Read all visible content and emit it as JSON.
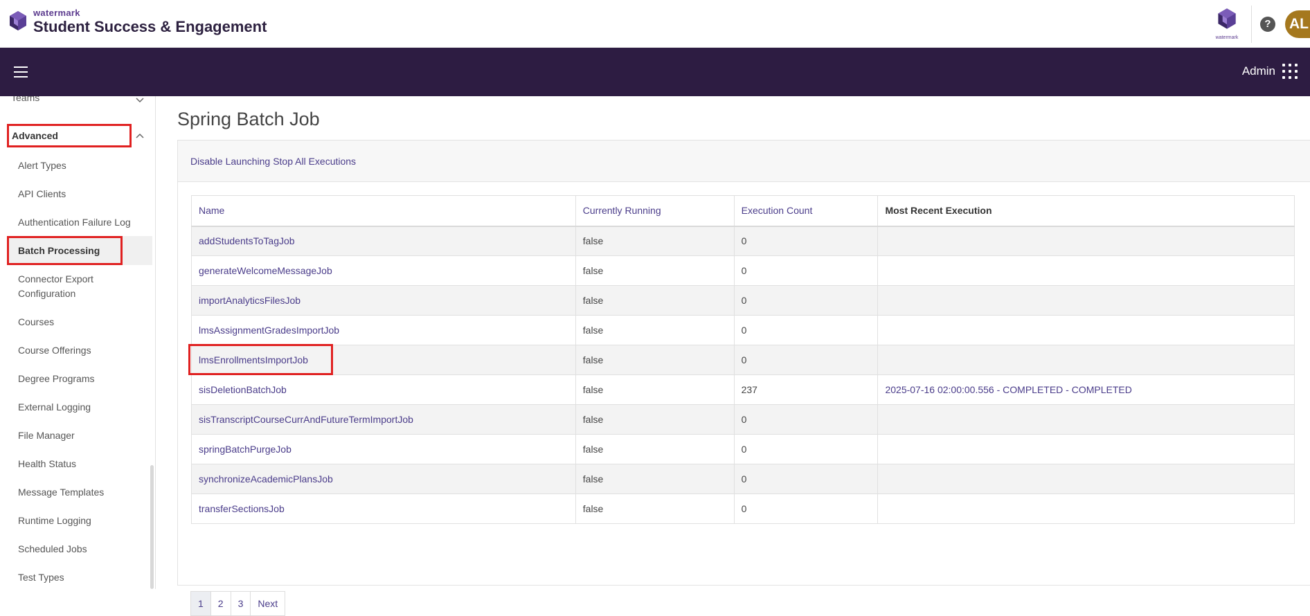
{
  "header": {
    "brand_small": "watermark",
    "brand_big": "Student Success & Engagement",
    "wm_caption": "watermark",
    "help_glyph": "?",
    "avatar_initials": "AL"
  },
  "navbar": {
    "admin_label": "Admin"
  },
  "sidebar": {
    "teams_label": "Teams",
    "advanced_label": "Advanced",
    "items": [
      "Alert Types",
      "API Clients",
      "Authentication Failure Log",
      "Batch Processing",
      "Connector Export",
      "Configuration",
      "Courses",
      "Course Offerings",
      "Degree Programs",
      "External Logging",
      "File Manager",
      "Health Status",
      "Message Templates",
      "Runtime Logging",
      "Scheduled Jobs",
      "Test Types"
    ]
  },
  "main": {
    "title": "Spring Batch Job",
    "actions": {
      "disable": "Disable Launching",
      "stop": "Stop All Executions"
    },
    "columns": {
      "name": "Name",
      "running": "Currently Running",
      "count": "Execution Count",
      "recent": "Most Recent Execution"
    },
    "rows": [
      {
        "name": "addStudentsToTagJob",
        "running": "false",
        "count": "0",
        "recent": ""
      },
      {
        "name": "generateWelcomeMessageJob",
        "running": "false",
        "count": "0",
        "recent": ""
      },
      {
        "name": "importAnalyticsFilesJob",
        "running": "false",
        "count": "0",
        "recent": ""
      },
      {
        "name": "lmsAssignmentGradesImportJob",
        "running": "false",
        "count": "0",
        "recent": ""
      },
      {
        "name": "lmsEnrollmentsImportJob",
        "running": "false",
        "count": "0",
        "recent": ""
      },
      {
        "name": "sisDeletionBatchJob",
        "running": "false",
        "count": "237",
        "recent": "2025-07-16 02:00:00.556 - COMPLETED - COMPLETED"
      },
      {
        "name": "sisTranscriptCourseCurrAndFutureTermImportJob",
        "running": "false",
        "count": "0",
        "recent": ""
      },
      {
        "name": "springBatchPurgeJob",
        "running": "false",
        "count": "0",
        "recent": ""
      },
      {
        "name": "synchronizeAcademicPlansJob",
        "running": "false",
        "count": "0",
        "recent": ""
      },
      {
        "name": "transferSectionsJob",
        "running": "false",
        "count": "0",
        "recent": ""
      }
    ],
    "pager": {
      "p1": "1",
      "p2": "2",
      "p3": "3",
      "next": "Next"
    }
  }
}
